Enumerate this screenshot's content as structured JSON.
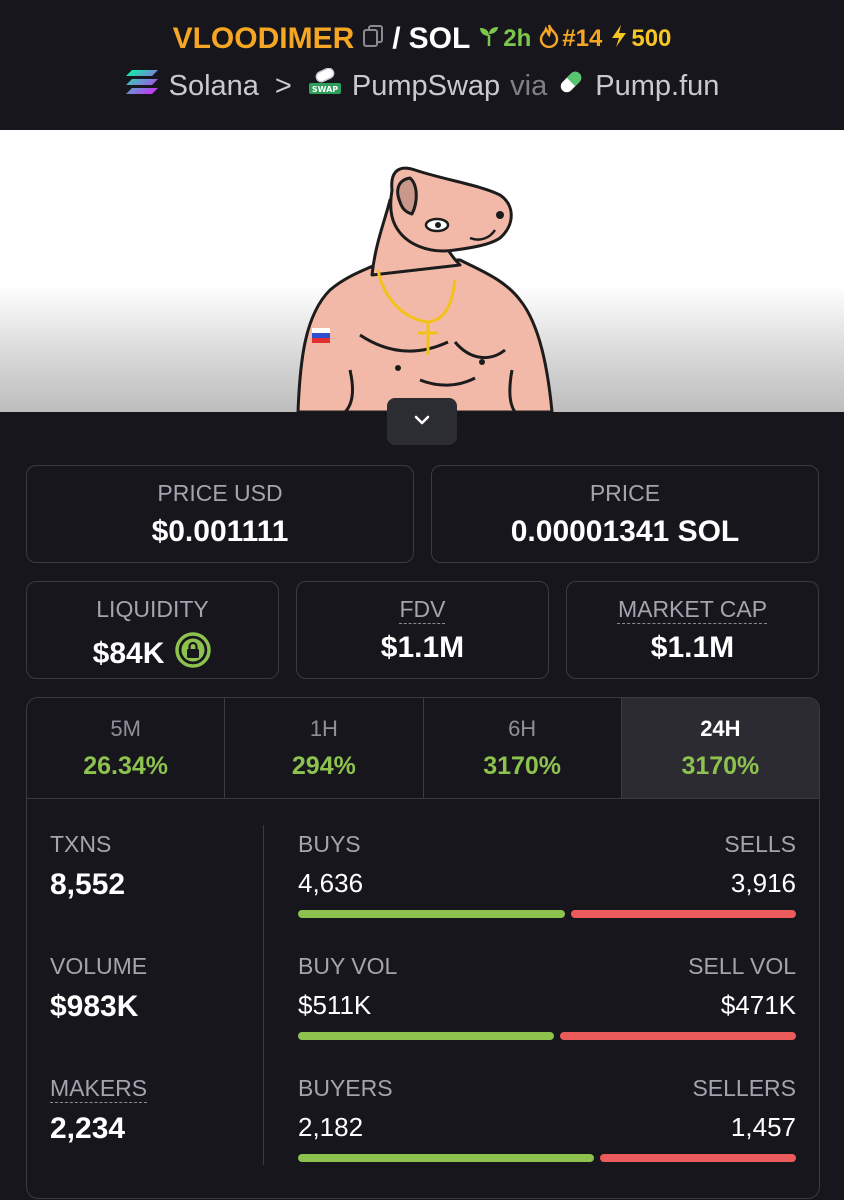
{
  "header": {
    "token": "VLOODIMER",
    "slash": "/",
    "quote": "SOL",
    "age": "2h",
    "rank": "#14",
    "boost": "500",
    "chain": "Solana",
    "sep": ">",
    "dex": "PumpSwap",
    "via": "via",
    "launchpad": "Pump.fun"
  },
  "prices": {
    "usd_label": "PRICE USD",
    "usd_value": "$0.001111",
    "native_label": "PRICE",
    "native_value": "0.00001341 SOL"
  },
  "metrics": {
    "liquidity_label": "LIQUIDITY",
    "liquidity_value": "$84K",
    "fdv_label": "FDV",
    "fdv_value": "$1.1M",
    "mcap_label": "MARKET CAP",
    "mcap_value": "$1.1M"
  },
  "tabs": [
    {
      "label": "5M",
      "value": "26.34%"
    },
    {
      "label": "1H",
      "value": "294%"
    },
    {
      "label": "6H",
      "value": "3170%"
    },
    {
      "label": "24H",
      "value": "3170%",
      "active": true
    }
  ],
  "stats": {
    "txns_label": "TXNS",
    "txns_value": "8,552",
    "volume_label": "VOLUME",
    "volume_value": "$983K",
    "makers_label": "MAKERS",
    "makers_value": "2,234"
  },
  "pairs": [
    {
      "left_label": "BUYS",
      "right_label": "SELLS",
      "left_value": "4,636",
      "right_value": "3,916",
      "buy_fraction": 0.542
    },
    {
      "left_label": "BUY VOL",
      "right_label": "SELL VOL",
      "left_value": "$511K",
      "right_value": "$471K",
      "buy_fraction": 0.52
    },
    {
      "left_label": "BUYERS",
      "right_label": "SELLERS",
      "left_value": "2,182",
      "right_value": "1,457",
      "buy_fraction": 0.6
    }
  ],
  "colors": {
    "accent_orange": "#f5a623",
    "green": "#8ec24f",
    "red": "#ec5b5b",
    "background": "#16161c"
  },
  "icons": [
    "copy-icon",
    "seedling-icon",
    "flame-icon",
    "bolt-icon",
    "solana-logo-icon",
    "pumpswap-logo-icon",
    "pill-icon",
    "chevron-down-icon",
    "lock-icon"
  ]
}
